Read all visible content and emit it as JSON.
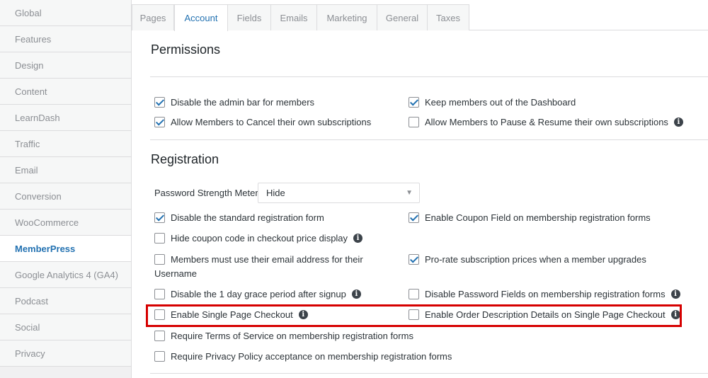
{
  "sidebar": {
    "items": [
      {
        "label": "Global"
      },
      {
        "label": "Features"
      },
      {
        "label": "Design"
      },
      {
        "label": "Content"
      },
      {
        "label": "LearnDash"
      },
      {
        "label": "Traffic"
      },
      {
        "label": "Email"
      },
      {
        "label": "Conversion"
      },
      {
        "label": "WooCommerce"
      },
      {
        "label": "MemberPress"
      },
      {
        "label": "Google Analytics 4 (GA4)"
      },
      {
        "label": "Podcast"
      },
      {
        "label": "Social"
      },
      {
        "label": "Privacy"
      }
    ],
    "active": "MemberPress"
  },
  "tabs": [
    {
      "label": "Pages"
    },
    {
      "label": "Account"
    },
    {
      "label": "Fields"
    },
    {
      "label": "Emails"
    },
    {
      "label": "Marketing"
    },
    {
      "label": "General"
    },
    {
      "label": "Taxes"
    }
  ],
  "active_tab": "Account",
  "permissions": {
    "heading": "Permissions",
    "options": [
      {
        "label": "Disable the admin bar for members",
        "checked": true
      },
      {
        "label": "Keep members out of the Dashboard",
        "checked": true
      },
      {
        "label": "Allow Members to Cancel their own subscriptions",
        "checked": true
      },
      {
        "label": "Allow Members to Pause & Resume their own subscriptions",
        "checked": false,
        "info": true
      }
    ]
  },
  "registration": {
    "heading": "Registration",
    "password_meter_label": "Password Strength Meter",
    "password_meter_value": "Hide",
    "options": [
      {
        "label": "Disable the standard registration form",
        "checked": true
      },
      {
        "label": "Enable Coupon Field on membership registration forms",
        "checked": true
      },
      {
        "label": "Hide coupon code in checkout price display",
        "checked": false,
        "info": true
      },
      {
        "label": "Members must use their email address for their",
        "label_line2": "Username",
        "checked": false
      },
      {
        "label": "Pro-rate subscription prices when a member upgrades",
        "checked": true
      },
      {
        "label": "Disable the 1 day grace period after signup",
        "checked": false,
        "info": true
      },
      {
        "label": "Disable Password Fields on membership registration forms",
        "checked": false,
        "info": true
      },
      {
        "label": "Enable Single Page Checkout",
        "checked": false,
        "info": true
      },
      {
        "label": "Enable Order Description Details on Single Page Checkout",
        "checked": false,
        "info": true
      },
      {
        "label": "Require Terms of Service on membership registration forms",
        "checked": false
      },
      {
        "label": "Require Privacy Policy acceptance on membership registration forms",
        "checked": false
      }
    ]
  },
  "icons": {
    "info": "info-icon",
    "checkbox": "checkbox",
    "dropdown": "chevron-down-icon"
  },
  "colors": {
    "accent": "#2271b1",
    "highlight": "#d60000"
  }
}
